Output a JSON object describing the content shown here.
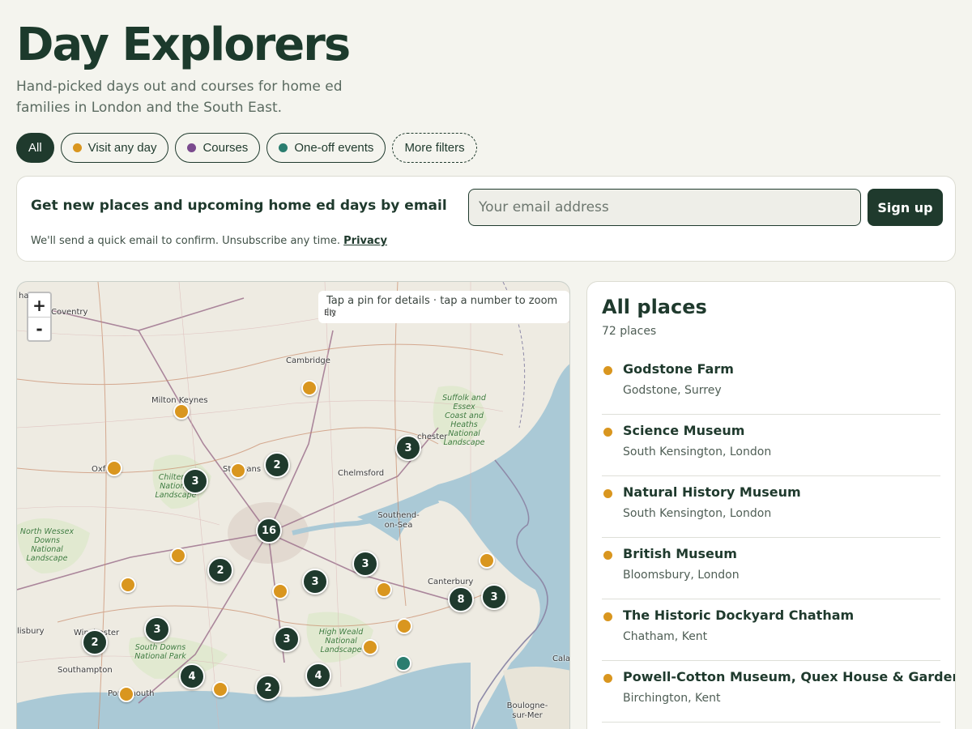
{
  "header": {
    "title": "Day Explorers",
    "subtitle": "Hand-picked days out and courses for home ed families in London and the South East."
  },
  "filters": [
    {
      "label": "All",
      "active": true,
      "color": null
    },
    {
      "label": "Visit any day",
      "color": "#d9961f"
    },
    {
      "label": "Courses",
      "color": "#7a4a8e"
    },
    {
      "label": "One-off events",
      "color": "#2a7d6f"
    },
    {
      "label": "More filters",
      "dashed": true
    }
  ],
  "signup": {
    "heading": "Get new places and upcoming home ed days by email",
    "note": "We'll send a quick email to confirm. Unsubscribe any time.",
    "privacy_link": "Privacy",
    "email_placeholder": "Your email address",
    "button_label": "Sign up"
  },
  "map": {
    "hint": "Tap a pin for details · tap a number to zoom in",
    "zoom_in": "+",
    "zoom_out": "-",
    "place_labels": [
      "Coventry",
      "Ely",
      "Cambridge",
      "Milton Keynes",
      "Chelmsford",
      "Southend-on-Sea",
      "Canterbury",
      "Southampton",
      "Boulogne-sur-Mer",
      "Oxf",
      "St Albans",
      "Calai",
      "lisbury",
      "Winchester",
      "Portsmouth",
      "chester",
      "ha"
    ],
    "park_labels": [
      "Suffolk and Essex Coast and Heaths National Landscape",
      "Chilterns National Landscape",
      "North Wessex Downs National Landscape",
      "High Weald National Landscape",
      "South Downs National Park"
    ],
    "clusters": [
      "3",
      "2",
      "3",
      "16",
      "2",
      "3",
      "3",
      "8",
      "3",
      "2",
      "3",
      "3",
      "4",
      "2",
      "4"
    ],
    "pin_colors": {
      "visit": "#d9961f",
      "event": "#2a7d6f"
    }
  },
  "list": {
    "title": "All places",
    "count": "72 places",
    "items": [
      {
        "name": "Godstone Farm",
        "location": "Godstone, Surrey",
        "color": "#d9961f"
      },
      {
        "name": "Science Museum",
        "location": "South Kensington, London",
        "color": "#d9961f"
      },
      {
        "name": "Natural History Museum",
        "location": "South Kensington, London",
        "color": "#d9961f"
      },
      {
        "name": "British Museum",
        "location": "Bloomsbury, London",
        "color": "#d9961f"
      },
      {
        "name": "The Historic Dockyard Chatham",
        "location": "Chatham, Kent",
        "color": "#d9961f"
      },
      {
        "name": "Powell-Cotton Museum, Quex House & Gardens",
        "location": "Birchington, Kent",
        "color": "#d9961f"
      }
    ]
  }
}
